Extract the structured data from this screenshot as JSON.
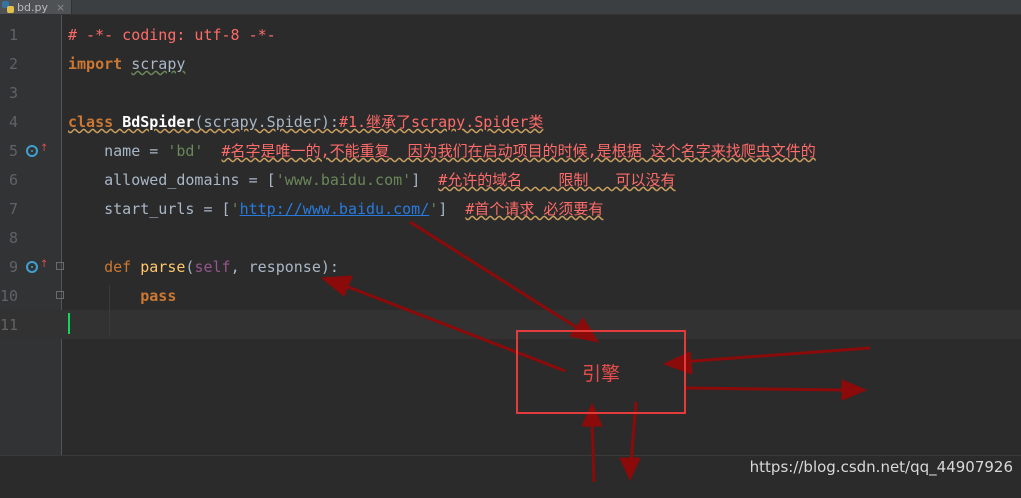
{
  "tab": {
    "filename": "bd.py",
    "close": "×"
  },
  "lines": [
    {
      "num": "1"
    },
    {
      "num": "2"
    },
    {
      "num": "3"
    },
    {
      "num": "4"
    },
    {
      "num": "5"
    },
    {
      "num": "6"
    },
    {
      "num": "7"
    },
    {
      "num": "8"
    },
    {
      "num": "9"
    },
    {
      "num": "10"
    },
    {
      "num": "11"
    }
  ],
  "code": {
    "l1": "# -*- coding: utf-8 -*-",
    "l2_kw": "import",
    "l2_mod": "scrapy",
    "l4_kw": "class",
    "l4_name": "BdSpider",
    "l4_args": "(scrapy.Spider):",
    "l4_comment": "#1.继承了scrapy.Spider类",
    "l5_var": "name = ",
    "l5_str": "'bd'",
    "l5_comment": "#名字是唯一的,不能重复  因为我们在启动项目的时候,是根据 这个名字来找爬虫文件的",
    "l6_var": "allowed_domains = [",
    "l6_str": "'www.baidu.com'",
    "l6_end": "]",
    "l6_comment": "#允许的域名    限制   可以没有",
    "l7_var": "start_urls = [",
    "l7_q1": "'",
    "l7_url": "http://www.baidu.com/",
    "l7_q2": "'",
    "l7_end": "]",
    "l7_comment": "#首个请求 必须要有",
    "l9_kw": "def",
    "l9_name": "parse",
    "l9_open": "(",
    "l9_self": "self",
    "l9_rest": ", response):",
    "l10_kw": "pass"
  },
  "annotation": {
    "engine_label": "引擎"
  },
  "watermark": "https://blog.csdn.net/qq_44907926",
  "colors": {
    "arrow": "#8b0a0a",
    "box": "#e23b3b",
    "caret": "#12d65c"
  }
}
